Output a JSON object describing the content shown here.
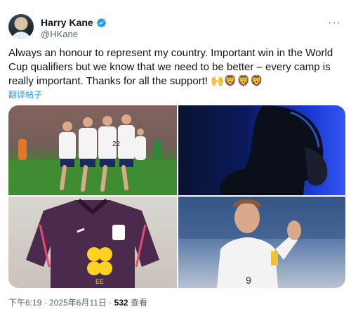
{
  "author": {
    "display_name": "Harry Kane",
    "handle": "@HKane",
    "verified": true
  },
  "tweet": {
    "text": "Always an honour to represent my country. Important win in the World Cup qualifiers but we know that we need to be better – every camp is really important. Thanks for all the support! 🙌🦁🦁🦁",
    "translate_label": "翻译帖子"
  },
  "media": {
    "count": 4,
    "shirt_sponsor_text": "EE",
    "shirt_number": "9"
  },
  "meta": {
    "time": "下午6:19",
    "separator": "·",
    "date": "2025年6月11日",
    "separator2": "·",
    "views_count": "532",
    "views_label": "查看"
  },
  "colors": {
    "accent": "#1d9bf0",
    "text_primary": "#0f1419",
    "text_secondary": "#536471"
  },
  "icons": {
    "verified": "verified-badge-icon",
    "more": "more-options-icon"
  }
}
